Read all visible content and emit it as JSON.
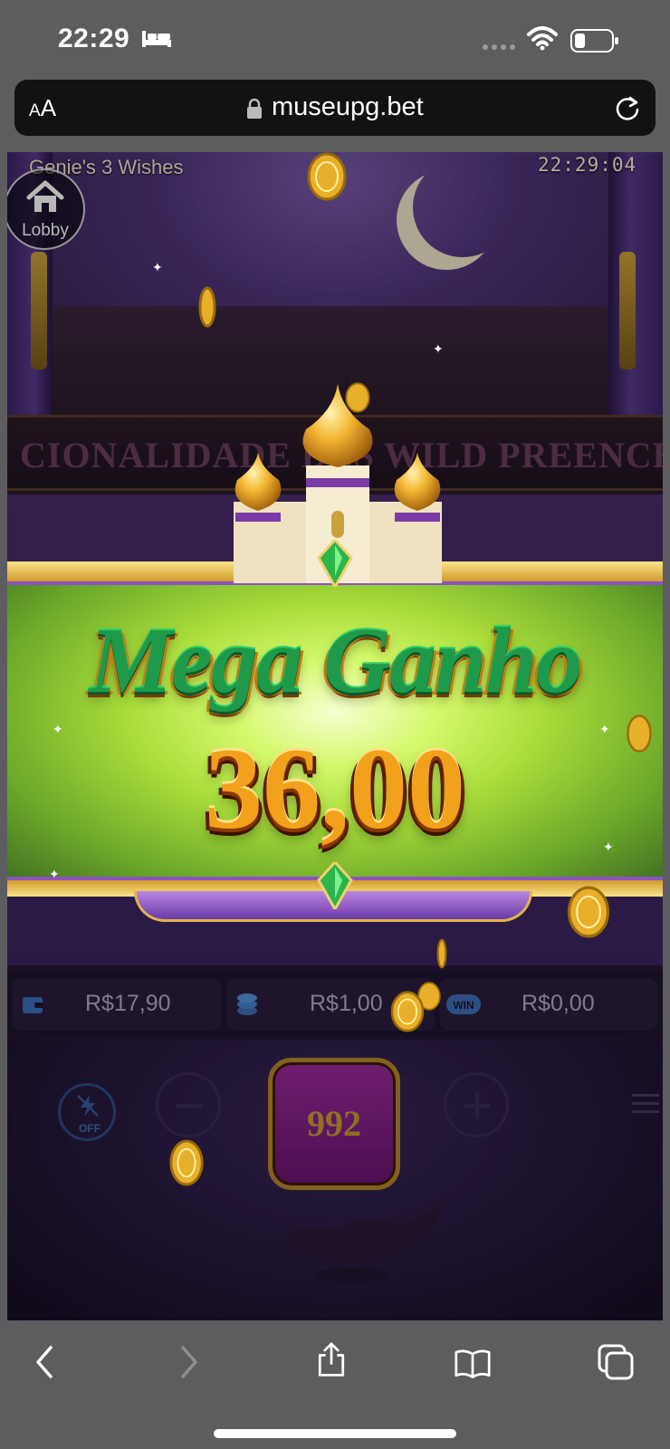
{
  "status_bar": {
    "time": "22:29",
    "sleep_icon": "bed-icon",
    "wifi_icon": "wifi-icon",
    "battery_icon": "battery-icon"
  },
  "browser": {
    "text_size_label_small": "A",
    "text_size_label_large": "A",
    "url": "museupg.bet",
    "lock_icon": "lock-icon",
    "reload_icon": "reload-icon"
  },
  "game": {
    "title": "Genie's 3 Wishes",
    "clock": "22:29:04",
    "lobby_label": "Lobby",
    "ticker_text": "CIONALIDADE DES     WILD PREENCHE A",
    "balance": "R$17,90",
    "bet": "R$1,00",
    "win": "R$0,00",
    "turbo_label": "OFF",
    "spin_count": "992"
  },
  "overlay": {
    "title": "Mega Ganho",
    "amount": "36,00"
  },
  "toolbar": {
    "back_icon": "back-icon",
    "forward_icon": "forward-icon",
    "share_icon": "share-icon",
    "bookmarks_icon": "bookmarks-icon",
    "tabs_icon": "tabs-icon"
  },
  "colors": {
    "banner_green": "#a8dc3a",
    "title_green": "#1f9a4a",
    "amount_gold": "#f2a11c",
    "spin_purple": "#7a1a80"
  }
}
